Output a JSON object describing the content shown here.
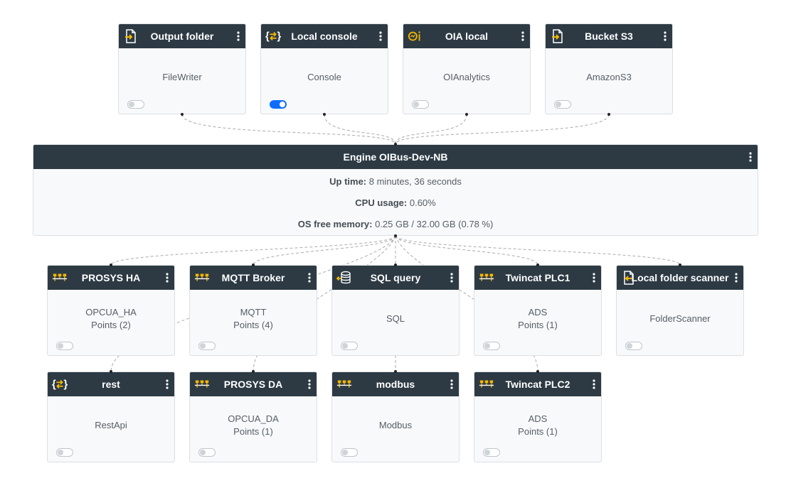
{
  "colors": {
    "header_bg": "#2d3a44",
    "icon_accent": "#f5b800",
    "toggle_on": "#0d6efd",
    "link": "#aaaaaa"
  },
  "north": [
    {
      "name": "Output folder",
      "type": "FileWriter",
      "icon": "file-export-icon",
      "enabled": false
    },
    {
      "name": "Local console",
      "type": "Console",
      "icon": "braces-arrows-icon",
      "enabled": true
    },
    {
      "name": "OIA local",
      "type": "OIAnalytics",
      "icon": "oia-logo-icon",
      "enabled": false
    },
    {
      "name": "Bucket S3",
      "type": "AmazonS3",
      "icon": "file-export-icon",
      "enabled": false
    }
  ],
  "engine": {
    "name": "Engine OIBus-Dev-NB",
    "uptime_label": "Up time:",
    "uptime_value": "8 minutes, 36 seconds",
    "cpu_label": "CPU usage:",
    "cpu_value": "0.60%",
    "memory_label": "OS free memory:",
    "memory_value": "0.25 GB / 32.00 GB (0.78 %)"
  },
  "south": [
    {
      "name": "PROSYS HA",
      "type": "OPCUA_HA",
      "points": "Points (2)",
      "icon": "network-icon",
      "enabled": false
    },
    {
      "name": "MQTT Broker",
      "type": "MQTT",
      "points": "Points (4)",
      "icon": "network-icon",
      "enabled": false
    },
    {
      "name": "SQL query",
      "type": "SQL",
      "points": "",
      "icon": "database-icon",
      "enabled": false
    },
    {
      "name": "Twincat PLC1",
      "type": "ADS",
      "points": "Points (1)",
      "icon": "network-icon",
      "enabled": false
    },
    {
      "name": "Local folder scanner",
      "type": "FolderScanner",
      "points": "",
      "icon": "file-import-icon",
      "enabled": false
    },
    {
      "name": "rest",
      "type": "RestApi",
      "points": "",
      "icon": "braces-arrows-icon",
      "enabled": false
    },
    {
      "name": "PROSYS DA",
      "type": "OPCUA_DA",
      "points": "Points (1)",
      "icon": "network-icon",
      "enabled": false
    },
    {
      "name": "modbus",
      "type": "Modbus",
      "points": "",
      "icon": "network-icon",
      "enabled": false
    },
    {
      "name": "Twincat PLC2",
      "type": "ADS",
      "points": "Points (1)",
      "icon": "network-icon",
      "enabled": false
    }
  ]
}
